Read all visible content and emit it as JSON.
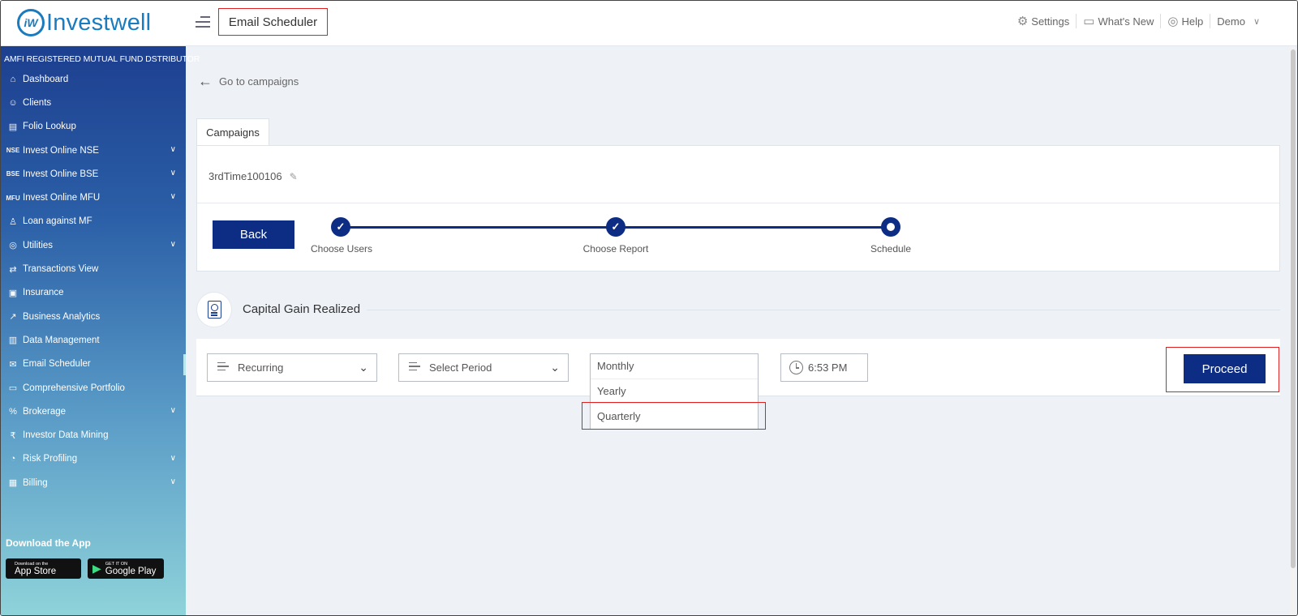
{
  "brand": {
    "logo_mark": "iW",
    "name": "Investwell"
  },
  "header": {
    "page_title": "Email Scheduler",
    "nav": [
      {
        "label": "Settings",
        "icon": "gear-icon"
      },
      {
        "label": "What's New",
        "icon": "chat-icon"
      },
      {
        "label": "Help",
        "icon": "lifebuoy-icon"
      },
      {
        "label": "Demo",
        "icon": "chevron-down-icon"
      }
    ]
  },
  "sidebar": {
    "tagline": "AMFI REGISTERED MUTUAL FUND DSTRIBUTOR",
    "items": [
      {
        "label": "Dashboard",
        "icon": "home-icon",
        "glyph": "⌂",
        "expandable": false
      },
      {
        "label": "Clients",
        "icon": "users-icon",
        "glyph": "☺",
        "expandable": false
      },
      {
        "label": "Folio Lookup",
        "icon": "folio-icon",
        "glyph": "▤",
        "expandable": false
      },
      {
        "label": "Invest Online NSE",
        "icon": "nse-icon",
        "glyph": "NSE",
        "expandable": true
      },
      {
        "label": "Invest Online BSE",
        "icon": "bse-icon",
        "glyph": "BSE",
        "expandable": true
      },
      {
        "label": "Invest Online MFU",
        "icon": "mfu-icon",
        "glyph": "MFU",
        "expandable": true
      },
      {
        "label": "Loan against MF",
        "icon": "loan-icon",
        "glyph": "♙",
        "expandable": false
      },
      {
        "label": "Utilities",
        "icon": "utilities-icon",
        "glyph": "◎",
        "expandable": true
      },
      {
        "label": "Transactions View",
        "icon": "transactions-icon",
        "glyph": "⇄",
        "expandable": false
      },
      {
        "label": "Insurance",
        "icon": "insurance-icon",
        "glyph": "▣",
        "expandable": false
      },
      {
        "label": "Business Analytics",
        "icon": "analytics-icon",
        "glyph": "↗",
        "expandable": false
      },
      {
        "label": "Data Management",
        "icon": "data-icon",
        "glyph": "▥",
        "expandable": false
      },
      {
        "label": "Email Scheduler",
        "icon": "email-icon",
        "glyph": "✉",
        "expandable": false,
        "active": true
      },
      {
        "label": "Comprehensive Portfolio",
        "icon": "portfolio-icon",
        "glyph": "▭",
        "expandable": false
      },
      {
        "label": "Brokerage",
        "icon": "brokerage-icon",
        "glyph": "%",
        "expandable": true
      },
      {
        "label": "Investor Data Mining",
        "icon": "mining-icon",
        "glyph": "₹",
        "expandable": false
      },
      {
        "label": "Risk Profiling",
        "icon": "risk-icon",
        "glyph": "◔",
        "expandable": true
      },
      {
        "label": "Billing",
        "icon": "billing-icon",
        "glyph": "▦",
        "expandable": true
      }
    ],
    "download_label": "Download the App",
    "app_store": {
      "small": "Download on the",
      "big": "App Store"
    },
    "google_play": {
      "small": "GET IT ON",
      "big": "Google Play"
    }
  },
  "main": {
    "back_link": "Go to campaigns",
    "tab_label": "Campaigns",
    "campaign_name": "3rdTime100106",
    "back_button": "Back",
    "steps": [
      {
        "label": "Choose Users",
        "state": "done"
      },
      {
        "label": "Choose Report",
        "state": "done"
      },
      {
        "label": "Schedule",
        "state": "current"
      }
    ],
    "report_title": "Capital Gain Realized",
    "schedule": {
      "frequency": "Recurring",
      "period_placeholder": "Select Period",
      "period_options": [
        "Monthly",
        "Yearly",
        "Quarterly"
      ],
      "highlighted_option": "Quarterly",
      "time": "6:53 PM"
    },
    "proceed_button": "Proceed"
  },
  "colors": {
    "primary": "#0c2d83",
    "brand": "#1a7bbf",
    "highlight": "#e02020"
  }
}
